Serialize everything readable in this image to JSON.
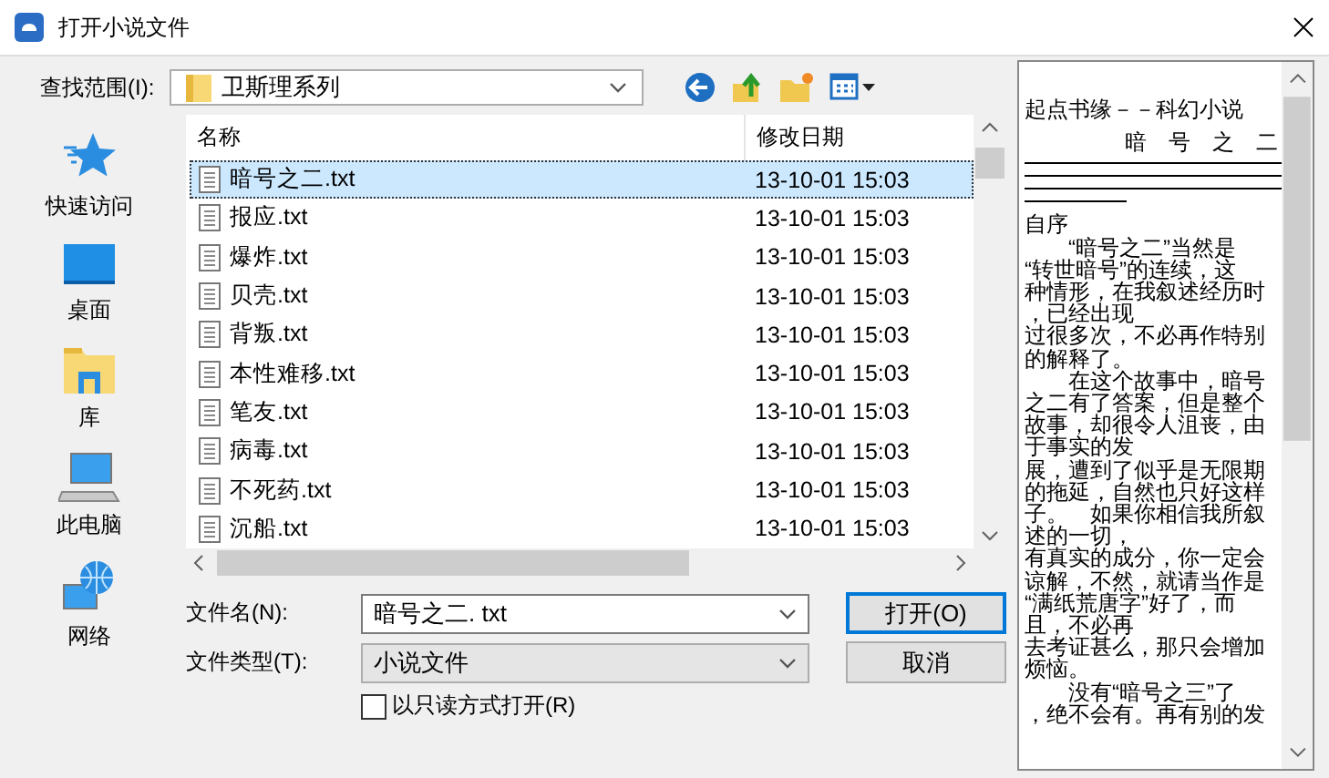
{
  "window": {
    "title": "打开小说文件"
  },
  "look_in": {
    "label": "查找范围(I):",
    "value": "卫斯理系列"
  },
  "places": [
    {
      "label": "快速访问",
      "kind": "star"
    },
    {
      "label": "桌面",
      "kind": "desktop"
    },
    {
      "label": "库",
      "kind": "library"
    },
    {
      "label": "此电脑",
      "kind": "computer"
    },
    {
      "label": "网络",
      "kind": "network"
    }
  ],
  "file_list": {
    "columns": [
      "名称",
      "修改日期"
    ],
    "rows": [
      {
        "name": "暗号之二.txt",
        "modified": "13-10-01 15:03",
        "selected": true
      },
      {
        "name": "报应.txt",
        "modified": "13-10-01 15:03",
        "selected": false
      },
      {
        "name": "爆炸.txt",
        "modified": "13-10-01 15:03",
        "selected": false
      },
      {
        "name": "贝壳.txt",
        "modified": "13-10-01 15:03",
        "selected": false
      },
      {
        "name": "背叛.txt",
        "modified": "13-10-01 15:03",
        "selected": false
      },
      {
        "name": "本性难移.txt",
        "modified": "13-10-01 15:03",
        "selected": false
      },
      {
        "name": "笔友.txt",
        "modified": "13-10-01 15:03",
        "selected": false
      },
      {
        "name": "病毒.txt",
        "modified": "13-10-01 15:03",
        "selected": false
      },
      {
        "name": "不死药.txt",
        "modified": "13-10-01 15:03",
        "selected": false
      },
      {
        "name": "沉船.txt",
        "modified": "13-10-01 15:03",
        "selected": false
      }
    ]
  },
  "file_name": {
    "label": "文件名(N):",
    "value": "暗号之二. txt"
  },
  "file_type": {
    "label": "文件类型(T):",
    "value": "小说文件"
  },
  "read_only": {
    "label": "以只读方式打开(R)",
    "checked": false
  },
  "buttons": [
    {
      "label": "打开(O)",
      "default": true
    },
    {
      "label": "取消",
      "default": false
    }
  ],
  "preview": {
    "lines": [
      {
        "kind": "text",
        "text": "起点书缘－－科幻小说"
      },
      {
        "kind": "right",
        "text": "暗　号　之　二"
      },
      {
        "kind": "rule"
      },
      {
        "kind": "rule"
      },
      {
        "kind": "rule"
      },
      {
        "kind": "short-rule"
      },
      {
        "kind": "text",
        "text": "自序"
      },
      {
        "kind": "text",
        "text": "　　“暗号之二”当然是"
      },
      {
        "kind": "text",
        "text": "“转世暗号”的连续，这"
      },
      {
        "kind": "text",
        "text": "种情形，在我叙述经历时"
      },
      {
        "kind": "text",
        "text": "，已经出现"
      },
      {
        "kind": "text",
        "text": "过很多次，不必再作特别"
      },
      {
        "kind": "text",
        "text": "的解释了。"
      },
      {
        "kind": "text",
        "text": "　　在这个故事中，暗号"
      },
      {
        "kind": "text",
        "text": "之二有了答案，但是整个"
      },
      {
        "kind": "text",
        "text": "故事，却很令人沮丧，由"
      },
      {
        "kind": "text",
        "text": "于事实的发"
      },
      {
        "kind": "text",
        "text": "展，遭到了似乎是无限期"
      },
      {
        "kind": "text",
        "text": "的拖延，自然也只好这样"
      },
      {
        "kind": "text",
        "text": "子。　如果你相信我所叙"
      },
      {
        "kind": "text",
        "text": "述的一切，"
      },
      {
        "kind": "text",
        "text": "有真实的成分，你一定会"
      },
      {
        "kind": "text",
        "text": "谅解，不然，就请当作是"
      },
      {
        "kind": "text",
        "text": "“满纸荒唐字”好了，而"
      },
      {
        "kind": "text",
        "text": "且，不必再"
      },
      {
        "kind": "text",
        "text": "去考证甚么，那只会增加"
      },
      {
        "kind": "text",
        "text": "烦恼。"
      },
      {
        "kind": "text",
        "text": "　　没有“暗号之三”了"
      },
      {
        "kind": "text",
        "text": "，绝不会有。再有别的发"
      }
    ]
  }
}
